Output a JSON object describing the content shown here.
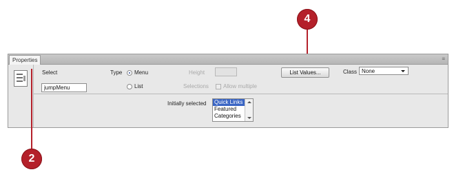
{
  "callouts": {
    "top": "4",
    "bottom": "2",
    "color": "#b4202a"
  },
  "panel": {
    "tab_label": "Properties",
    "menu_icon": "≡",
    "element_icon": "list-menu-icon",
    "select_label": "Select",
    "select_name": "jumpMenu",
    "type_label": "Type",
    "type_options": [
      "Menu",
      "List"
    ],
    "type_selected": "Menu",
    "height_label": "Height",
    "selections_label": "Selections",
    "allow_multiple_label": "Allow multiple",
    "list_values_button": "List Values...",
    "class_label": "Class",
    "class_value": "None",
    "initially_selected_label": "Initially selected",
    "initially_selected_options": [
      "Quick Links",
      "Featured",
      "Categories"
    ],
    "initially_selected_value": "Quick Links",
    "selection_color": "#3a65c4"
  }
}
